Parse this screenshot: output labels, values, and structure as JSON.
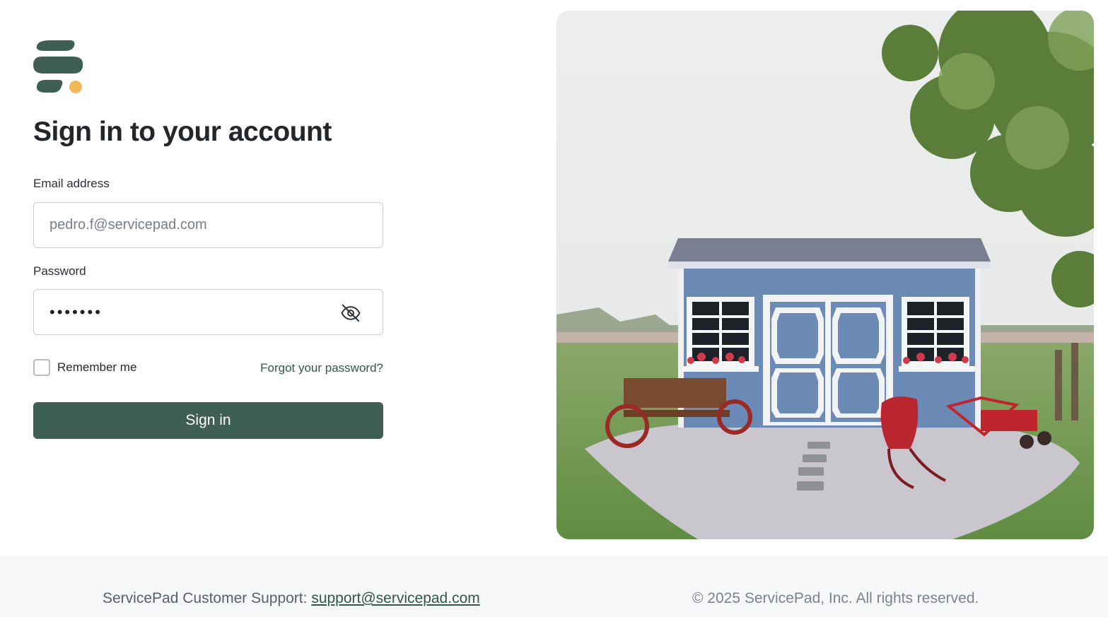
{
  "brand": {
    "logo_name": "ServicePad logo",
    "primary_color": "#3f5f56",
    "accent_color": "#f2b95a"
  },
  "form": {
    "title": "Sign in to your account",
    "email_label": "Email address",
    "email_placeholder": "pedro.f@servicepad.com",
    "password_label": "Password",
    "password_value": "•••••••",
    "password_toggle_icon": "eye-off-icon",
    "remember_label": "Remember me",
    "forgot_label": "Forgot your password?",
    "submit_label": "Sign in"
  },
  "hero": {
    "image_alt": "blue storage shed with white doors on gravel patio"
  },
  "footer": {
    "support_text": "ServicePad Customer Support:",
    "support_email": "support@servicepad.com",
    "copyright": "© 2025 ServicePad, Inc. All rights reserved."
  }
}
